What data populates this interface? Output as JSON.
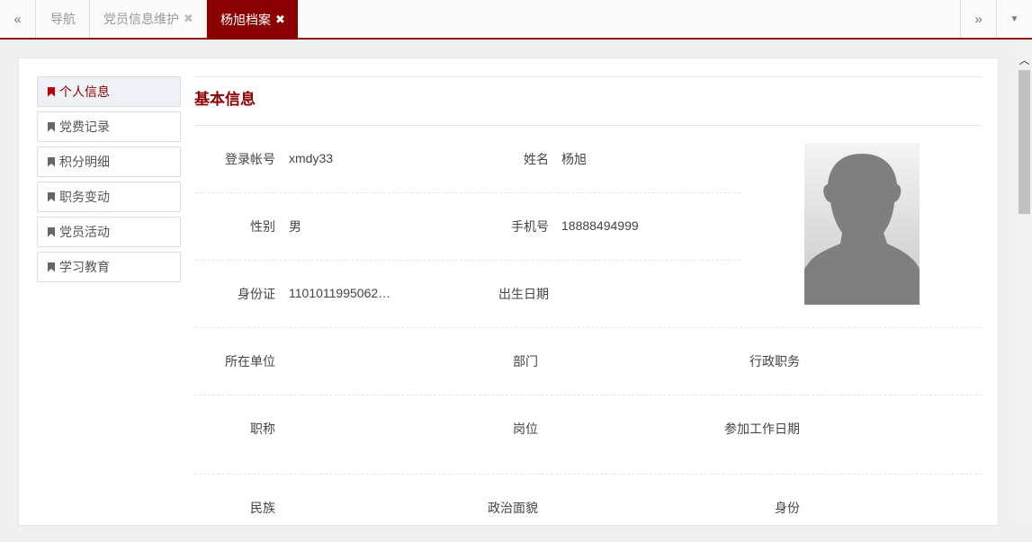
{
  "tabbar": {
    "scroll_left": "«",
    "scroll_right": "»",
    "dropdown": "▼",
    "tabs": [
      {
        "label": "导航"
      },
      {
        "label": "党员信息维护",
        "close": "✖"
      },
      {
        "label": "杨旭档案",
        "close": "✖",
        "active": true
      }
    ]
  },
  "sidebar": {
    "items": [
      {
        "label": "个人信息",
        "icon": "bookmark-icon",
        "active": true
      },
      {
        "label": "党费记录",
        "icon": "bookmark-icon"
      },
      {
        "label": "积分明细",
        "icon": "bookmark-icon"
      },
      {
        "label": "职务变动",
        "icon": "bookmark-icon"
      },
      {
        "label": "党员活动",
        "icon": "bookmark-icon"
      },
      {
        "label": "学习教育",
        "icon": "bookmark-icon"
      }
    ]
  },
  "basic_info": {
    "title": "基本信息",
    "login_label": "登录帐号",
    "login_value": "xmdy33",
    "name_label": "姓名",
    "name_value": "杨旭",
    "gender_label": "性别",
    "gender_value": "男",
    "phone_label": "手机号",
    "phone_value": "18888494999",
    "idcard_label": "身份证",
    "idcard_value": "1101011995062…",
    "birth_label": "出生日期",
    "birth_value": "",
    "unit_label": "所在单位",
    "unit_value": "",
    "dept_label": "部门",
    "dept_value": "",
    "admin_post_label": "行政职务",
    "admin_post_value": "",
    "title_label": "职称",
    "title_value": "",
    "position_label": "岗位",
    "position_value": "",
    "work_date_label": "参加工作日期",
    "work_date_value": "",
    "ethnic_label": "民族",
    "ethnic_value": "",
    "political_label": "政治面貌",
    "political_value": "",
    "identity_label": "身份",
    "identity_value": ""
  },
  "colors": {
    "accent": "#8b0000",
    "active_bookmark": "#c00000"
  }
}
